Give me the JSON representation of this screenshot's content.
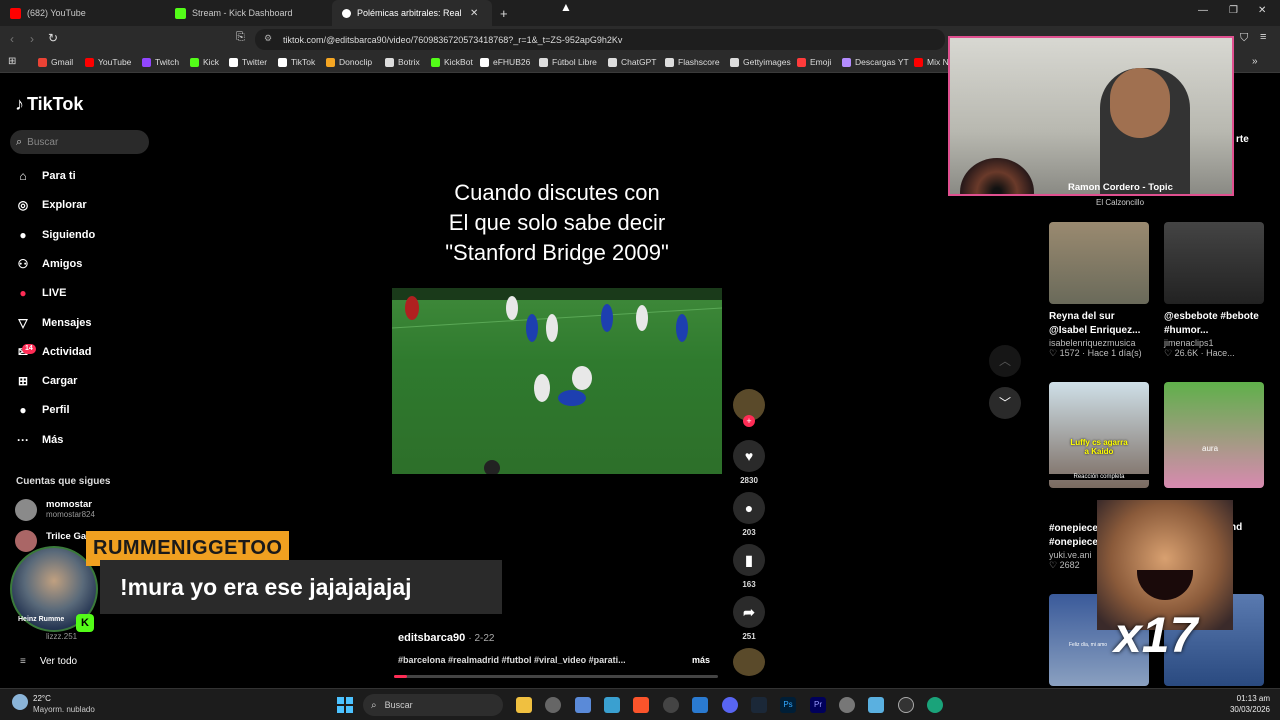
{
  "browser": {
    "tabs": [
      {
        "label": "(682) YouTube",
        "color": "#ff0000"
      },
      {
        "label": "Stream - Kick Dashboard",
        "color": "#53fc18"
      },
      {
        "label": "Polémicas arbitrales: Real Ma",
        "color": "#ffffff"
      }
    ],
    "new_tab": "+",
    "url": "tiktok.com/@editsbarca90/video/7609836720573418768?_r=1&_t=ZS-952apG9h2Kv",
    "bookmarks": [
      {
        "label": "Gmail",
        "color": "#ea4335"
      },
      {
        "label": "YouTube",
        "color": "#ff0000"
      },
      {
        "label": "Twitch",
        "color": "#9146ff"
      },
      {
        "label": "Kick",
        "color": "#53fc18"
      },
      {
        "label": "Twitter",
        "color": "#ffffff"
      },
      {
        "label": "TikTok",
        "color": "#ffffff"
      },
      {
        "label": "Donoclip",
        "color": "#f5a623"
      },
      {
        "label": "Botrix",
        "color": "#dddddd"
      },
      {
        "label": "KickBot",
        "color": "#53fc18"
      },
      {
        "label": "eFHUB26",
        "color": "#ffffff"
      },
      {
        "label": "Fútbol Libre",
        "color": "#dddddd"
      },
      {
        "label": "ChatGPT",
        "color": "#dddddd"
      },
      {
        "label": "Flashscore",
        "color": "#dddddd"
      },
      {
        "label": "Gettyimages",
        "color": "#dddddd"
      },
      {
        "label": "Emoji",
        "color": "#ff3b3b"
      },
      {
        "label": "Descargas YT",
        "color": "#b48cff"
      },
      {
        "label": "Mix N",
        "color": "#ff0000"
      }
    ]
  },
  "tiktok": {
    "logo": "TikTok",
    "search_placeholder": "Buscar",
    "nav": [
      {
        "label": "Para ti",
        "icon": "home-icon",
        "glyph": "⌂"
      },
      {
        "label": "Explorar",
        "icon": "compass-icon",
        "glyph": "◎"
      },
      {
        "label": "Siguiendo",
        "icon": "following-avatar-icon",
        "glyph": "●"
      },
      {
        "label": "Amigos",
        "icon": "friends-icon",
        "glyph": "⚇"
      },
      {
        "label": "LIVE",
        "icon": "live-icon",
        "glyph": "●"
      },
      {
        "label": "Mensajes",
        "icon": "inbox-icon",
        "glyph": "▽"
      },
      {
        "label": "Actividad",
        "icon": "activity-icon",
        "glyph": "✉"
      },
      {
        "label": "Cargar",
        "icon": "upload-icon",
        "glyph": "⊞"
      },
      {
        "label": "Perfil",
        "icon": "profile-icon",
        "glyph": "●"
      },
      {
        "label": "Más",
        "icon": "more-icon",
        "glyph": "···"
      }
    ],
    "activity_badge": "14",
    "following_header": "Cuentas que sigues",
    "following": [
      {
        "name": "momostar",
        "handle": "momostar824"
      },
      {
        "name": "Trilce Ga",
        "handle": ""
      },
      {
        "name": "",
        "handle": "lizzz.251"
      }
    ],
    "see_all": "Ver todo",
    "video": {
      "caption_lines": [
        "Cuando discutes con",
        "El que solo sabe decir",
        "\"Stanford Bridge 2009\""
      ],
      "author": "editsbarca90",
      "date": "2-22",
      "hashtags": "#barcelona #realmadrid #futbol #viral_video #parati...",
      "more": "más",
      "likes": "2830",
      "comments": "203",
      "saves": "163",
      "shares": "251"
    },
    "right_videos": [
      {
        "title": "Reyna del sur @Isabel Enriquez...",
        "user": "isabelenriquezmusica",
        "likes": "1572",
        "time": "Hace 1 día(s)"
      },
      {
        "title": "@esbebote #bebote #humor...",
        "user": "jimenaclips1",
        "likes": "26.6K",
        "time": "Hace..."
      },
      {
        "title": "#onepiece #onepiece",
        "user": "yuki.ve.ani",
        "likes": "2682",
        "time": ""
      },
      {
        "title": "nd",
        "user": "",
        "likes": "",
        "time": ""
      }
    ],
    "thumb_texts": {
      "luffy": "Luffy cs agarra a Kaido",
      "reaction": "Reacción completa",
      "aura": "aura",
      "feliz": "Feliz día, mi amo"
    },
    "right_header": "rte"
  },
  "stream_overlay": {
    "webcam_song_title": "Ramon Cordero - Topic",
    "webcam_song_sub": "El Calzoncillo",
    "chat_user": "RUMMENIGGETOO",
    "chat_message": "!mura yo era ese jajajajajaj",
    "avatar_caption": "Heinz Rumme",
    "emote_multiplier": "x17"
  },
  "taskbar": {
    "weather_temp": "22°C",
    "weather_desc": "Mayorm. nublado",
    "search": "Buscar",
    "time": "01:13 am",
    "date": "30/03/2026"
  }
}
